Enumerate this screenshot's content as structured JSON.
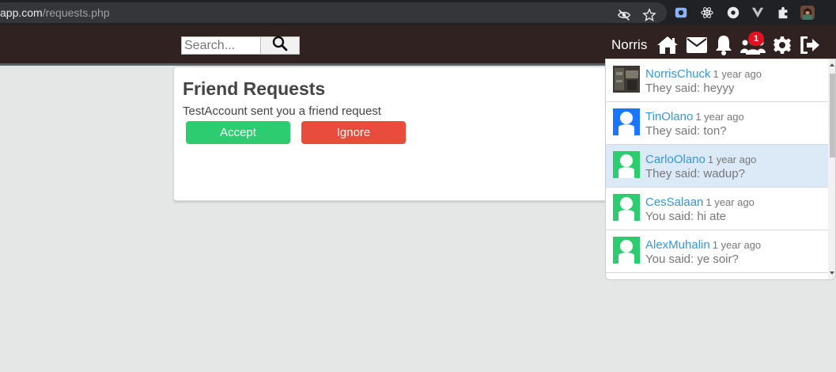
{
  "browser": {
    "url_domain": "app.com",
    "url_path": "/requests.php",
    "icons": [
      "eye-slash-icon",
      "star-icon",
      "screen-capture-icon",
      "react-icon",
      "circle-extension-icon",
      "vue-icon",
      "puzzle-extension-icon",
      "profile-avatar"
    ]
  },
  "navbar": {
    "search_placeholder": "Search...",
    "username": "Norris",
    "notification_count": "1",
    "icons": [
      "home-icon",
      "envelope-icon",
      "bell-icon",
      "friends-icon",
      "gear-icon",
      "logout-icon"
    ]
  },
  "friend_requests": {
    "title": "Friend Requests",
    "request_text": "TestAccount sent you a friend request",
    "accept_label": "Accept",
    "ignore_label": "Ignore"
  },
  "messages": [
    {
      "name": "NorrisChuck",
      "time": "1 year ago",
      "preview": "They said: heyyy",
      "avatar": "photo",
      "active": false
    },
    {
      "name": "TinOlano",
      "time": "1 year ago",
      "preview": "They said: ton?",
      "avatar": "blue",
      "active": false
    },
    {
      "name": "CarloOlano",
      "time": "1 year ago",
      "preview": "They said: wadup?",
      "avatar": "green",
      "active": true
    },
    {
      "name": "CesSalaan",
      "time": "1 year ago",
      "preview": "You said: hi ate",
      "avatar": "green",
      "active": false
    },
    {
      "name": "AlexMuhalin",
      "time": "1 year ago",
      "preview": "You said: ye soir?",
      "avatar": "green",
      "active": false
    }
  ],
  "colors": {
    "navbar_bg": "#2f2220",
    "accept": "#2ecc71",
    "ignore": "#e74c3c",
    "link": "#3498db",
    "badge": "#e3111f",
    "avatar_blue": "#1a75ff",
    "avatar_green": "#2ecc71"
  }
}
